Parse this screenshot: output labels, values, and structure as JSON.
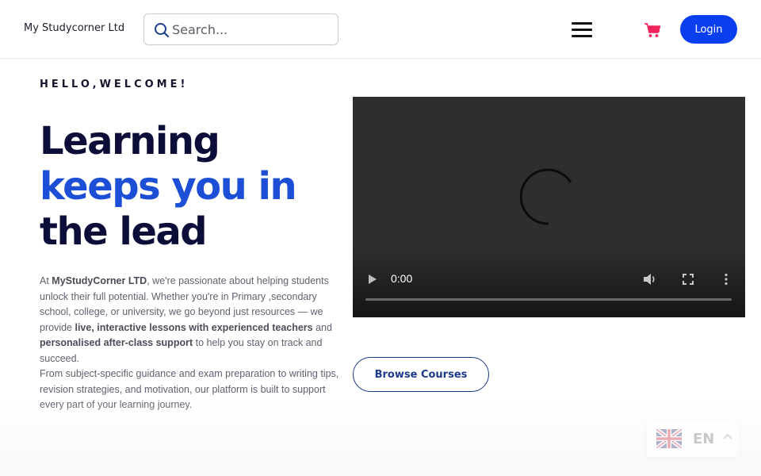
{
  "header": {
    "brand": "My Studycorner Ltd",
    "search_placeholder": "Search...",
    "login_label": "Login",
    "icons": [
      "search-icon",
      "hamburger-menu-icon",
      "cart-icon"
    ],
    "accent_color": "#0a3ff0",
    "cart_color": "#f0245a"
  },
  "hero": {
    "eyebrow": "HELLO,WELCOME!",
    "headline": {
      "line1": "Learning",
      "line2": "keeps you in",
      "line3": "the lead"
    },
    "intro": {
      "p1_a": "At ",
      "p1_brand": "MyStudyCorner LTD",
      "p1_b": ", we're passionate about helping students unlock their full potential. Whether you're in Primary ,secondary school, college, or university, we go beyond just resources — we provide ",
      "p1_bold1": "live, interactive lessons with experienced teachers",
      "p1_c": " and ",
      "p1_bold2": "personalised after-class support",
      "p1_d": " to help you stay on track and succeed.",
      "p2": "From subject-specific guidance and exam preparation to writing tips, revision strategies, and motivation, our platform is built to support every part of your learning journey."
    },
    "headline_colors": {
      "dark": "#0d0d3a",
      "blue": "#1d4fd6"
    }
  },
  "video": {
    "time": "0:00",
    "progress": 0,
    "icons": [
      "spinner-icon",
      "play-icon",
      "volume-icon",
      "fullscreen-icon",
      "more-options-icon"
    ]
  },
  "cta": {
    "browse_label": "Browse Courses"
  },
  "language": {
    "code": "EN",
    "flag": "uk-flag-icon"
  }
}
